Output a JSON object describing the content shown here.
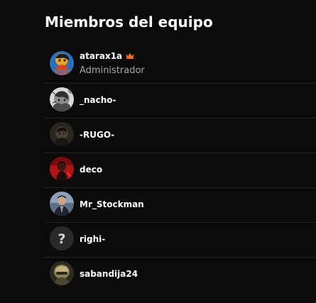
{
  "section": {
    "title": "Miembros del equipo"
  },
  "members": [
    {
      "name": "atarax1a",
      "role": "Administrador",
      "avatar": "anime-character-avatar",
      "badge": "crown-icon"
    },
    {
      "name": "_nacho-",
      "avatar": "sketch-avatar"
    },
    {
      "name": "-RUGO-",
      "avatar": "dark-portrait-avatar"
    },
    {
      "name": "deco",
      "avatar": "red-character-avatar"
    },
    {
      "name": "Mr_Stockman",
      "avatar": "suited-man-avatar"
    },
    {
      "name": "righi-",
      "avatar": "default-question-avatar"
    },
    {
      "name": "sabandija24",
      "avatar": "helmet-avatar"
    }
  ],
  "colors": {
    "background": "#0b0b0b",
    "text": "#ffffff",
    "muted": "#a7a7a7",
    "divider": "#242424",
    "crown": "#f26a1b"
  }
}
